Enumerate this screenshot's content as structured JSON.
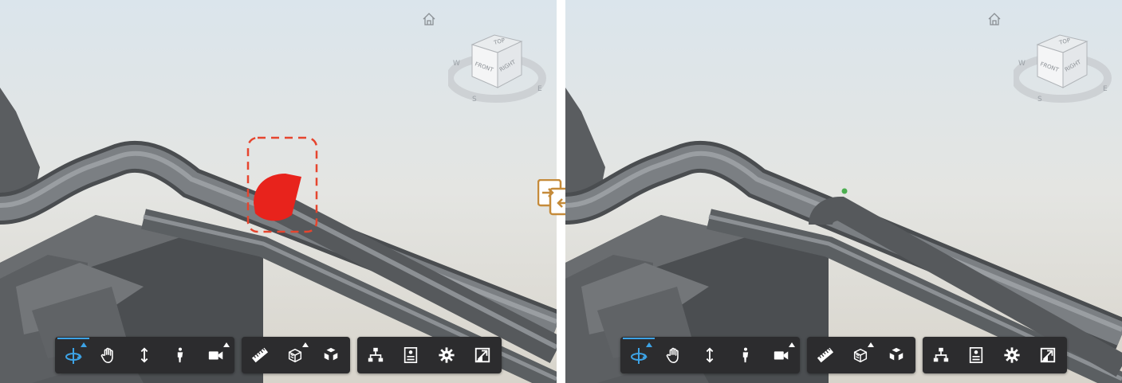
{
  "viewcube": {
    "face_top": "TOP",
    "face_front": "FRONT",
    "face_right": "RIGHT",
    "compass": [
      "W",
      "S",
      "E"
    ]
  },
  "colors": {
    "selection_red": "#e8231c",
    "selection_outline": "#e6452e",
    "toolbar_bg": "#2c2c2e",
    "active_blue": "#3da3e6",
    "compare_icon": "#c58b3a",
    "marker_green": "#4caf50"
  },
  "toolbar": {
    "groups": [
      {
        "items": [
          {
            "icon": "orbit-icon",
            "active": true,
            "flyout": true
          },
          {
            "icon": "pan-icon"
          },
          {
            "icon": "zoom-icon"
          },
          {
            "icon": "first-person-icon"
          },
          {
            "icon": "camera-icon",
            "flyout": true
          }
        ]
      },
      {
        "items": [
          {
            "icon": "measure-icon"
          },
          {
            "icon": "section-icon",
            "flyout": true
          },
          {
            "icon": "explode-icon"
          }
        ]
      },
      {
        "items": [
          {
            "icon": "model-browser-icon"
          },
          {
            "icon": "properties-icon"
          },
          {
            "icon": "settings-icon"
          },
          {
            "icon": "fullscreen-icon"
          }
        ]
      }
    ]
  },
  "compare": {
    "icon": "compare-files-icon"
  }
}
